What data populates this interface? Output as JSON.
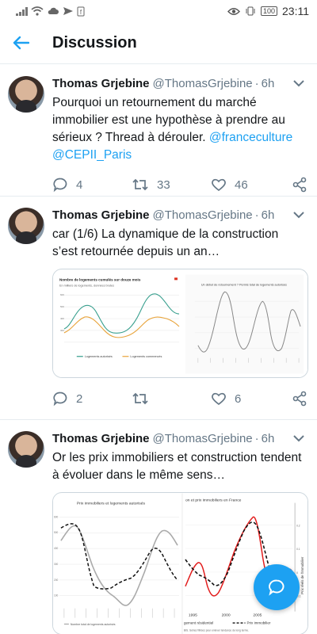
{
  "status": {
    "time": "23:11",
    "battery": "100"
  },
  "header": {
    "title": "Discussion"
  },
  "tweets": [
    {
      "author": "Thomas Grjebine",
      "handle": "@ThomasGrjebine",
      "time": "6h",
      "text_plain": "Pourquoi un retournement du marché immobilier est une hypothèse à prendre au sérieux ? Thread à dérouler. ",
      "mention1": "@franceculture",
      "mention2": "@CEPII_Paris",
      "replies": "4",
      "retweets": "33",
      "likes": "46"
    },
    {
      "author": "Thomas Grjebine",
      "handle": "@ThomasGrjebine",
      "time": "6h",
      "text": "car (1/6) La dynamique de la construction s’est retournée depuis un an…",
      "replies": "2",
      "retweets": "",
      "likes": "6",
      "chart_a": {
        "title": "Nombre de logements cumulés sur douze mois",
        "subtitle": "En milliers de logements, données brutes",
        "legend_a": "Logements autorisés",
        "legend_b": "Logements commencés"
      },
      "chart_b": {
        "title": "Un début de retournement ? Permis total de logements autorisés"
      }
    },
    {
      "author": "Thomas Grjebine",
      "handle": "@ThomasGrjebine",
      "time": "6h",
      "text": "Or les prix immobiliers et construction tendent à évoluer dans le même sens…",
      "chart_a": {
        "title": "Prix immobiliers et logements autorisés",
        "legend": "Nombre total de logements autorisés"
      },
      "chart_b": {
        "title": "on et prix immobiliers en France",
        "legend_a": "gement résidentiel",
        "legend_b": "Prix immobilier",
        "ylabel": "Prix réels de l'immobilier",
        "xticks": [
          "1995",
          "2000",
          "2005"
        ],
        "note": "BIS. Séries filtrées pour enlever tendance de long terme."
      }
    }
  ],
  "colors": {
    "accent": "#1da1f2",
    "secondary": "#657786"
  }
}
